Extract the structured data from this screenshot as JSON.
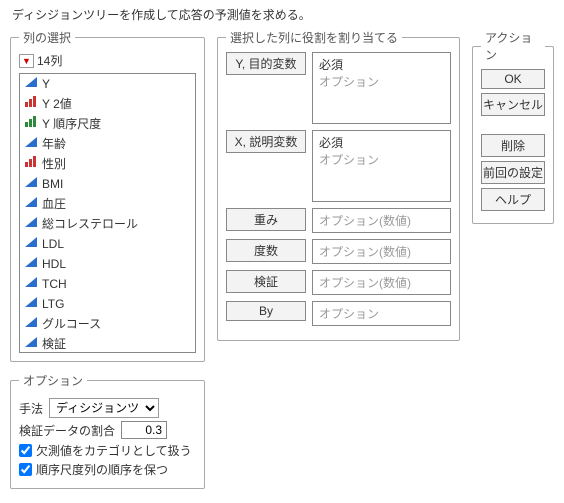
{
  "description": "ディシジョンツリーを作成して応答の予測値を求める。",
  "columns": {
    "legend": "列の選択",
    "count_label": "14列",
    "items": [
      {
        "label": "Y",
        "icon": "cont-blue"
      },
      {
        "label": "Y 2値",
        "icon": "bars-red"
      },
      {
        "label": "Y 順序尺度",
        "icon": "bars-green"
      },
      {
        "label": "年齢",
        "icon": "cont-blue"
      },
      {
        "label": "性別",
        "icon": "bars-red"
      },
      {
        "label": "BMI",
        "icon": "cont-blue"
      },
      {
        "label": "血圧",
        "icon": "cont-blue"
      },
      {
        "label": "総コレステロール",
        "icon": "cont-blue"
      },
      {
        "label": "LDL",
        "icon": "cont-blue"
      },
      {
        "label": "HDL",
        "icon": "cont-blue"
      },
      {
        "label": "TCH",
        "icon": "cont-blue"
      },
      {
        "label": "LTG",
        "icon": "cont-blue"
      },
      {
        "label": "グルコース",
        "icon": "cont-blue"
      },
      {
        "label": "検証",
        "icon": "cont-blue"
      }
    ]
  },
  "roles": {
    "legend": "選択した列に役割を割り当てる",
    "y": {
      "btn": "Y, 目的変数",
      "req": "必須",
      "opt": "オプション"
    },
    "x": {
      "btn": "X, 説明変数",
      "req": "必須",
      "opt": "オプション"
    },
    "wgt": {
      "btn": "重み",
      "opt": "オプション(数値)"
    },
    "freq": {
      "btn": "度数",
      "opt": "オプション(数値)"
    },
    "val": {
      "btn": "検証",
      "opt": "オプション(数値)"
    },
    "by": {
      "btn": "By",
      "opt": "オプション"
    }
  },
  "actions": {
    "legend": "アクション",
    "ok": "OK",
    "cancel": "キャンセル",
    "remove": "削除",
    "recall": "前回の設定",
    "help": "ヘルプ"
  },
  "options": {
    "legend": "オプション",
    "method_label": "手法",
    "method_value": "ディシジョンツリー",
    "valid_label": "検証データの割合",
    "valid_value": "0.3",
    "chk_missing": "欠測値をカテゴリとして扱う",
    "chk_ordinal": "順序尺度列の順序を保つ"
  }
}
